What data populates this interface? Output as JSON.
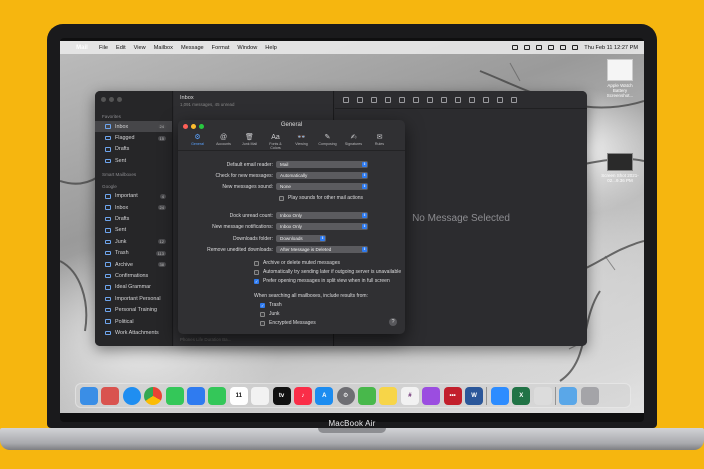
{
  "device_label": "MacBook Air",
  "menubar": {
    "apple": "",
    "app_name": "Mail",
    "items": [
      "File",
      "Edit",
      "View",
      "Mailbox",
      "Message",
      "Format",
      "Window",
      "Help"
    ],
    "datetime": "Thu Feb 11  12:27 PM"
  },
  "desktop": {
    "file_caption": "Apple Watch Battery Screenshot...",
    "screenshot_caption": "Screen Shot 2021-02...9.36 PM"
  },
  "mail": {
    "list_title": "Inbox",
    "list_subtitle": "1,091 messages, 45 unread",
    "list_footer": "Phones Life Duration Ba...",
    "no_selection": "No Message Selected",
    "sidebar": {
      "favorites_label": "Favorites",
      "favorites": [
        {
          "label": "Inbox",
          "count": "24",
          "selected": true
        },
        {
          "label": "Flagged",
          "count": "15"
        },
        {
          "label": "Drafts",
          "count": ""
        },
        {
          "label": "Sent",
          "count": ""
        }
      ],
      "smart_label": "Smart Mailboxes",
      "account_label": "Google",
      "account": [
        {
          "label": "Important",
          "count": "4"
        },
        {
          "label": "Inbox",
          "count": "24"
        },
        {
          "label": "Drafts",
          "count": ""
        },
        {
          "label": "Sent",
          "count": ""
        },
        {
          "label": "Junk",
          "count": "12"
        },
        {
          "label": "Trash",
          "count": "113"
        },
        {
          "label": "Archive",
          "count": "38"
        },
        {
          "label": "Confirmations",
          "count": ""
        },
        {
          "label": "Ideal Grammar",
          "count": ""
        },
        {
          "label": "Important Personal",
          "count": ""
        },
        {
          "label": "Personal Training",
          "count": ""
        },
        {
          "label": "Political",
          "count": ""
        },
        {
          "label": "Work Attachments",
          "count": ""
        }
      ]
    }
  },
  "prefs": {
    "title": "General",
    "tabs": [
      {
        "label": "General",
        "glyph": "⚙"
      },
      {
        "label": "Accounts",
        "glyph": "@"
      },
      {
        "label": "Junk Mail",
        "glyph": "🗑"
      },
      {
        "label": "Fonts & Colors",
        "glyph": "Aa"
      },
      {
        "label": "Viewing",
        "glyph": "👓"
      },
      {
        "label": "Composing",
        "glyph": "✎"
      },
      {
        "label": "Signatures",
        "glyph": "✍"
      },
      {
        "label": "Rules",
        "glyph": "✉"
      }
    ],
    "rows": [
      {
        "label": "Default email reader:",
        "value": "Mail"
      },
      {
        "label": "Check for new messages:",
        "value": "Automatically"
      },
      {
        "label": "New messages sound:",
        "value": "None"
      },
      {
        "label": "Dock unread count:",
        "value": "Inbox Only"
      },
      {
        "label": "New message notifications:",
        "value": "Inbox Only"
      },
      {
        "label": "Downloads folder:",
        "value": "Downloads"
      },
      {
        "label": "Remove unedited downloads:",
        "value": "After Message is Deleted"
      }
    ],
    "play_sounds": "Play sounds for other mail actions",
    "options": [
      {
        "label": "Archive or delete muted messages",
        "checked": false
      },
      {
        "label": "Automatically try sending later if outgoing server is unavailable",
        "checked": false
      },
      {
        "label": "Prefer opening messages in split view when in full screen",
        "checked": true
      }
    ],
    "search_heading": "When searching all mailboxes, include results from:",
    "search_opts": [
      {
        "label": "Trash",
        "checked": true
      },
      {
        "label": "Junk",
        "checked": false
      },
      {
        "label": "Encrypted Messages",
        "checked": false
      }
    ],
    "help": "?"
  },
  "dock": {
    "apps": [
      {
        "name": "finder-icon",
        "color": "#3a8ee6"
      },
      {
        "name": "launchpad-icon",
        "color": "#d9534f"
      },
      {
        "name": "safari-icon",
        "color": "#1f8ef1"
      },
      {
        "name": "chrome-icon",
        "color": "#e8e8e8"
      },
      {
        "name": "messages-icon",
        "color": "#34c759"
      },
      {
        "name": "mail-icon",
        "color": "#2f7bf0"
      },
      {
        "name": "facetime-icon",
        "color": "#34c759"
      },
      {
        "name": "calendar-icon",
        "color": "#ffffff"
      },
      {
        "name": "reminders-icon",
        "color": "#f2f2f2"
      },
      {
        "name": "tv-icon",
        "color": "#111111"
      },
      {
        "name": "music-icon",
        "color": "#fa2d48"
      },
      {
        "name": "app-store-icon",
        "color": "#1c8cf0"
      },
      {
        "name": "system-preferences-icon",
        "color": "#6e6e73"
      },
      {
        "name": "maps-icon",
        "color": "#48b84b"
      },
      {
        "name": "notes-icon",
        "color": "#f7d548"
      },
      {
        "name": "slack-icon",
        "color": "#f2f2f2"
      },
      {
        "name": "podcasts-icon",
        "color": "#9b4de0"
      },
      {
        "name": "lastpass-icon",
        "color": "#c21f2c"
      },
      {
        "name": "word-icon",
        "color": "#2b579a"
      },
      {
        "name": "zoom-icon",
        "color": "#2d8cff"
      },
      {
        "name": "excel-icon",
        "color": "#217346"
      },
      {
        "name": "preview-icon",
        "color": "#dcdcdc"
      },
      {
        "name": "downloads-icon",
        "color": "#5aa7e8"
      },
      {
        "name": "trash-icon",
        "color": "#a4a4a8"
      }
    ],
    "calendar_day": "11",
    "tv_label": "tv",
    "word_letter": "W",
    "excel_letter": "X"
  }
}
